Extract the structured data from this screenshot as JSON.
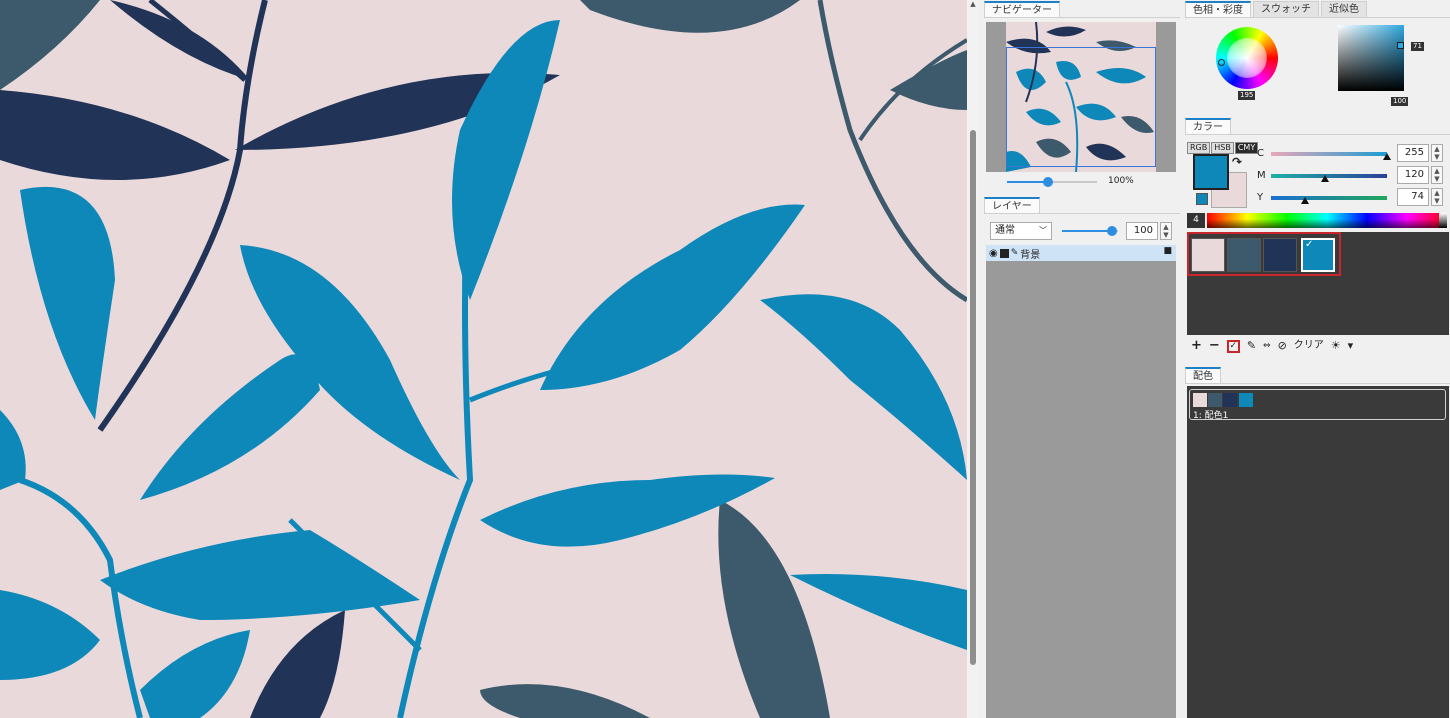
{
  "navigator": {
    "tab": "ナビゲーター",
    "zoom": "100%",
    "zoom_fraction": 0.45
  },
  "layers": {
    "tab": "レイヤー",
    "blend_mode": "通常",
    "opacity": "100",
    "opacity_fraction": 0.9,
    "items": [
      {
        "name": "背景"
      }
    ]
  },
  "color_tabs": [
    "色相・彩度",
    "スウォッチ",
    "近似色"
  ],
  "hue_wheel": {
    "hue_value": "195"
  },
  "sv_square": {
    "sat_value": "71",
    "val_value": "100"
  },
  "color_panel": {
    "tab": "カラー",
    "modes": [
      "RGB",
      "HSB",
      "CMY"
    ],
    "active_mode": "CMY",
    "foreground": "#0e88b8",
    "background": "#ead9da",
    "sliders": [
      {
        "label": "C",
        "value": "255",
        "fraction": 1.0
      },
      {
        "label": "M",
        "value": "120",
        "fraction": 0.47
      },
      {
        "label": "Y",
        "value": "74",
        "fraction": 0.29
      }
    ],
    "spectrum_label": "4"
  },
  "swatches": {
    "colors": [
      "#ead9da",
      "#3d5a6c",
      "#213457",
      "#0e88b8"
    ],
    "selected_index": 3,
    "toolbar": {
      "add": "+",
      "remove": "−",
      "check": "✓",
      "edit": "✎",
      "swap": "⇔",
      "none": "⊘",
      "clear": "クリア",
      "light": "☀",
      "menu": "▾"
    }
  },
  "color_scheme": {
    "tab": "配色",
    "items": [
      {
        "label": "1: 配色1",
        "colors": [
          "#ead9da",
          "#3d5a6c",
          "#213457",
          "#0e88b8"
        ]
      }
    ]
  },
  "palette": {
    "bg": "#ead9da",
    "slate": "#3d5a6c",
    "navy": "#213457",
    "teal": "#0e88b8",
    "accent": "#1d7fc6",
    "highlight_red": "#c8252c"
  }
}
